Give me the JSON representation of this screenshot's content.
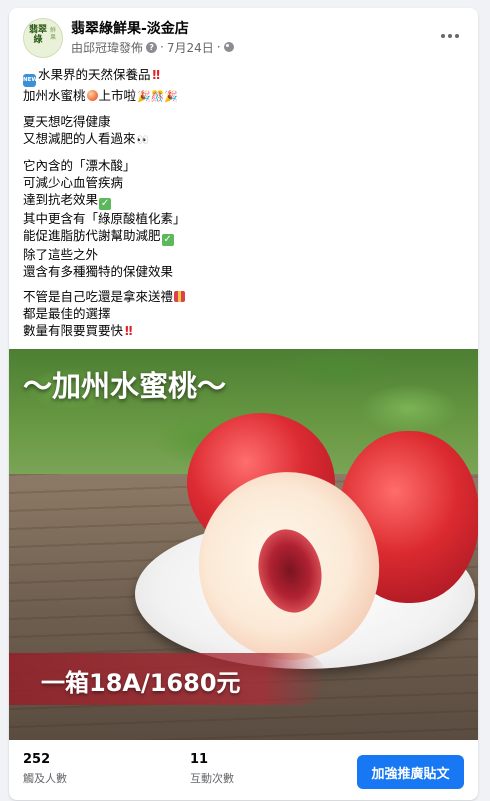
{
  "post": {
    "page_name": "翡翠綠鮮果-淡金店",
    "author": "由邱冠瑋發佈",
    "date": "7月24日",
    "separator": "·",
    "avatar_text": "翡翠綠",
    "avatar_side_text": "鮮果",
    "icons": {
      "more": "more-options-icon",
      "info": "question-icon",
      "audience": "globe-icon"
    }
  },
  "content": {
    "p1": [
      "水果界的天然保養品",
      "加州水蜜桃",
      "上市啦"
    ],
    "p2": [
      "夏天想吃得健康",
      "又想減肥的人看過來"
    ],
    "p3": [
      "它內含的「漂木酸」",
      "可減少心血管疾病",
      "達到抗老效果",
      "其中更含有「綠原酸植化素」",
      "能促進脂肪代謝幫助減肥",
      "除了這些之外",
      "還含有多種獨特的保健效果"
    ],
    "p4": [
      "不管是自己吃還是拿來送禮",
      "都是最佳的選擇",
      "數量有限要買要快"
    ],
    "emoji": {
      "new": "NEW",
      "double_excl": "!!",
      "party": "🎉🎊🎉",
      "eyes": "👀",
      "check": "✓"
    }
  },
  "image": {
    "title": "～加州水蜜桃～",
    "price": "一箱18A/1680元"
  },
  "stats": {
    "reach_value": "252",
    "reach_label": "觸及人數",
    "engagement_value": "11",
    "engagement_label": "互動次數"
  },
  "actions": {
    "boost_label": "加強推廣貼文"
  },
  "colors": {
    "accent": "#1877f2",
    "secondary_text": "#65676b"
  }
}
